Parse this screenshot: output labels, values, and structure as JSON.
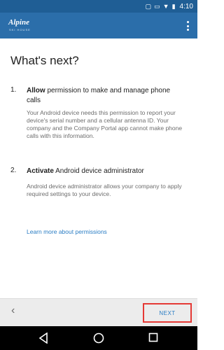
{
  "status_bar": {
    "time": "4:10",
    "icons": [
      "vibrate-icon",
      "no-sim-icon",
      "wifi-icon",
      "battery-icon"
    ]
  },
  "app_bar": {
    "logo_text": "Alpine",
    "logo_subtext": "SKI HOUSE",
    "menu_icon": "overflow-menu-icon"
  },
  "page": {
    "title": "What's next?",
    "steps": [
      {
        "number": "1.",
        "heading_bold": "Allow",
        "heading_rest": " permission to make and manage phone calls",
        "body": "Your Android device needs this permission to report your device's serial number and a cellular antenna ID. Your company and the Company Portal app cannot make phone calls with this information."
      },
      {
        "number": "2.",
        "heading_bold": "Activate",
        "heading_rest": " Android device administrator",
        "body": "Android device administrator allows your company to apply required settings to your device."
      }
    ],
    "learn_more": "Learn more about permissions"
  },
  "bottom_bar": {
    "back_icon": "chevron-left-icon",
    "next_label": "NEXT"
  },
  "nav_bar": {
    "icons": [
      "back-triangle-icon",
      "home-circle-icon",
      "recents-square-icon"
    ]
  }
}
